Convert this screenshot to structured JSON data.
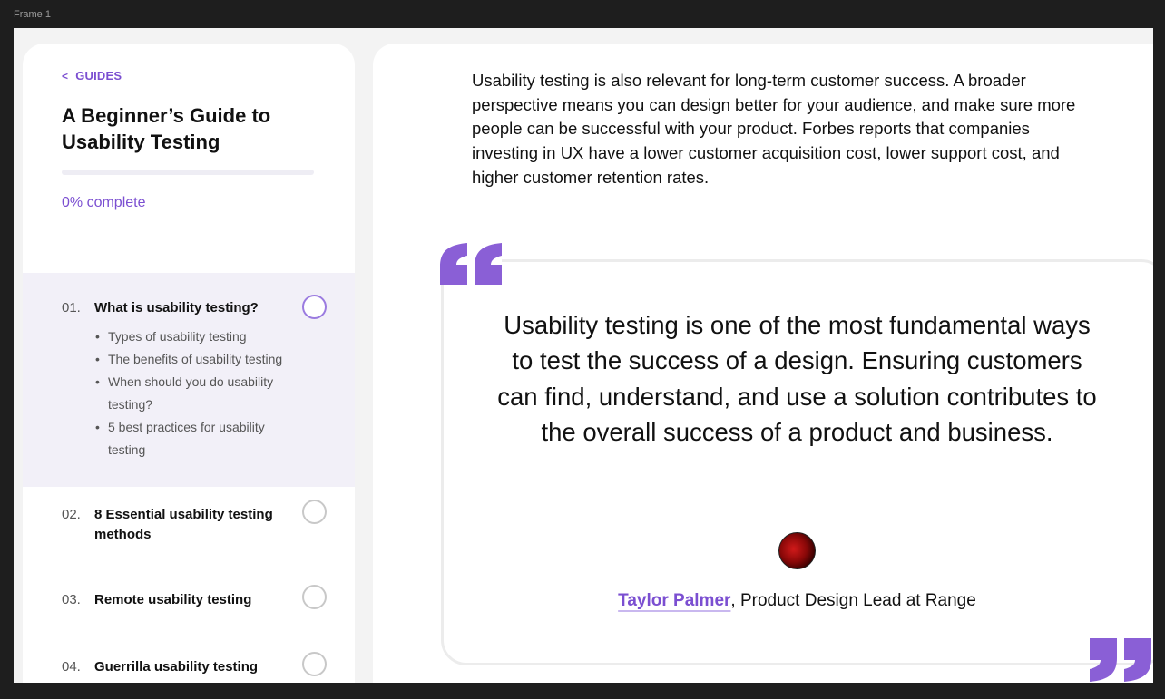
{
  "frame": {
    "label": "Frame 1"
  },
  "sidebar": {
    "back_link": "GUIDES",
    "title": "A Beginner’s Guide to Usability Testing",
    "progress_percent": 0,
    "progress_text": "0% complete",
    "items": [
      {
        "num": "01.",
        "label": "What is usability testing?",
        "active": true,
        "subitems": [
          "Types of usability testing",
          "The benefits of usability testing",
          "When should you do usability testing?",
          "5 best practices for usability testing"
        ]
      },
      {
        "num": "02.",
        "label": "8 Essential usability testing methods"
      },
      {
        "num": "03.",
        "label": "Remote usability testing"
      },
      {
        "num": "04.",
        "label": "Guerrilla usability testing"
      }
    ]
  },
  "main": {
    "intro": "Usability testing is also relevant for long-term customer success. A broader perspective means you can design better for your audience, and make sure more people can be successful with your product. Forbes reports that companies investing in UX have a lower customer acquisition cost, lower support cost, and higher customer retention rates.",
    "quote": {
      "text": "Usability testing is one of the most fundamental ways to test the success of a design. Ensuring customers can find, understand, and use a solution contributes to the overall success of a product and business.",
      "author": "Taylor Palmer",
      "role": ", Product Design Lead at Range"
    }
  },
  "colors": {
    "accent": "#7b4fd1",
    "quote_mark": "#8a5fd6",
    "active_bg": "#f2f0f8"
  },
  "icons": {
    "back": "chevron-left-icon",
    "quote_open": "quote-open-icon",
    "quote_close": "quote-close-icon",
    "status": "circle-status-icon"
  }
}
